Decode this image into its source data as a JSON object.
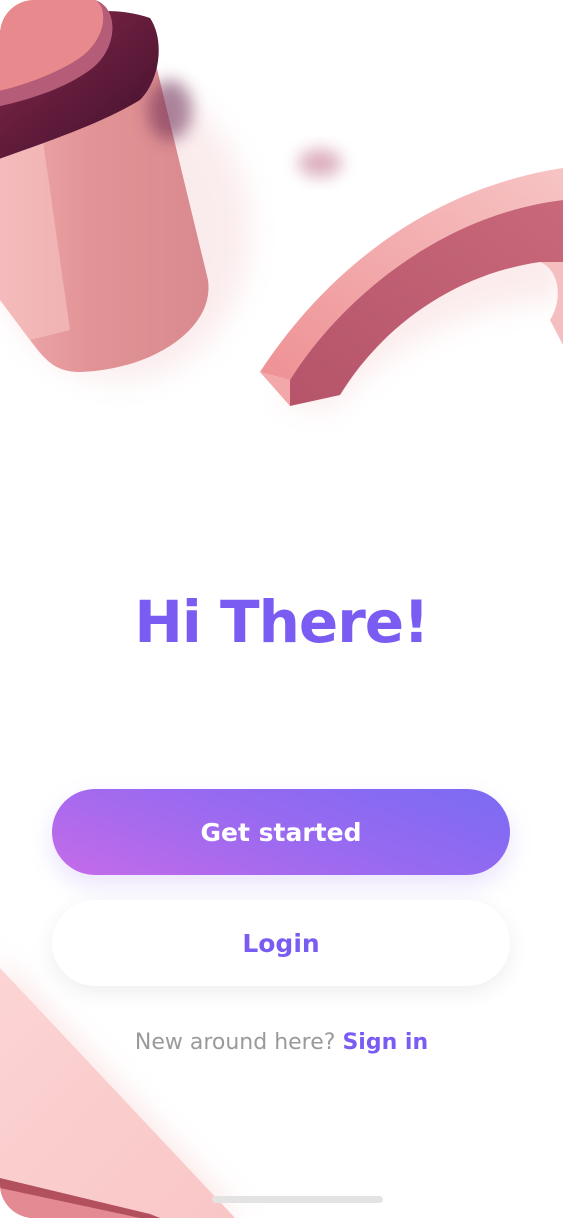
{
  "welcome": {
    "title": "Hi There!"
  },
  "actions": {
    "get_started_label": "Get started",
    "login_label": "Login"
  },
  "footer": {
    "prompt": "New around here?",
    "signin_label": "Sign in"
  },
  "colors": {
    "accent": "#7B5CF2",
    "gradient_start": "#7A6BF3",
    "gradient_end": "#C56BE8",
    "decor_pink": "#E99598"
  }
}
